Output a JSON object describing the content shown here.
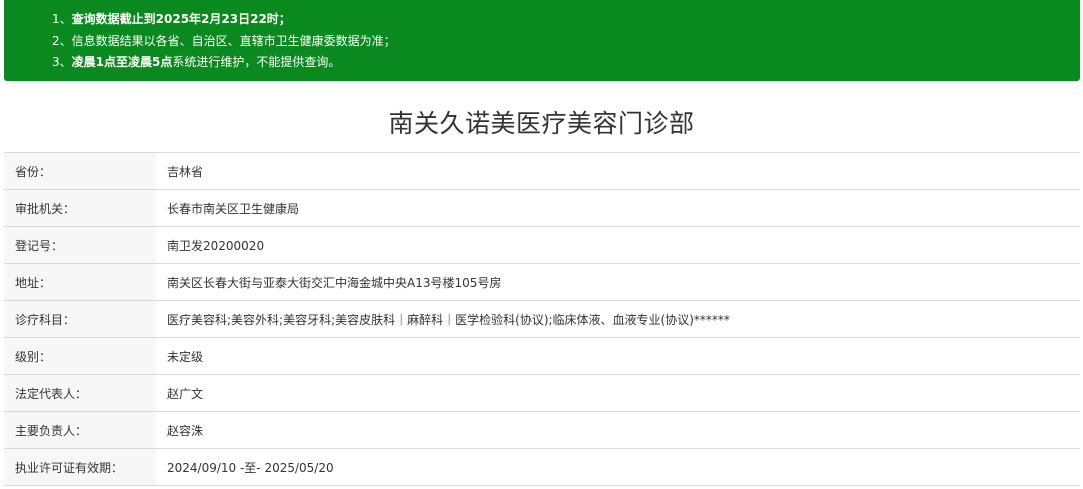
{
  "notice": {
    "line1_prefix": "1、",
    "line1_bold": "查询数据截止到2025年2月23日22时；",
    "line2": "2、信息数据结果以各省、自治区、直辖市卫生健康委数据为准；",
    "line3_prefix": "3、",
    "line3_bold": "凌晨1点至凌晨5点",
    "line3_rest": "系统进行维护，不能提供查询。",
    "bg_color": "#0a8a1e"
  },
  "title": "南关久诺美医疗美容门诊部",
  "rows": [
    {
      "label": "省份：",
      "value": "吉林省"
    },
    {
      "label": "审批机关：",
      "value": "长春市南关区卫生健康局"
    },
    {
      "label": "登记号：",
      "value": "南卫发20200020"
    },
    {
      "label": "地址：",
      "value": "南关区长春大街与亚泰大街交汇中海金城中央A13号楼105号房"
    },
    {
      "label": "诊疗科目：",
      "value": "医疗美容科;美容外科;美容牙科;美容皮肤科｜麻醉科｜医学检验科(协议);临床体液、血液专业(协议)******"
    },
    {
      "label": "级别：",
      "value": "未定级"
    },
    {
      "label": "法定代表人：",
      "value": "赵广文"
    },
    {
      "label": "主要负责人：",
      "value": "赵容洙"
    },
    {
      "label": "执业许可证有效期：",
      "value": "2024/09/10 -至- 2025/05/20"
    }
  ]
}
